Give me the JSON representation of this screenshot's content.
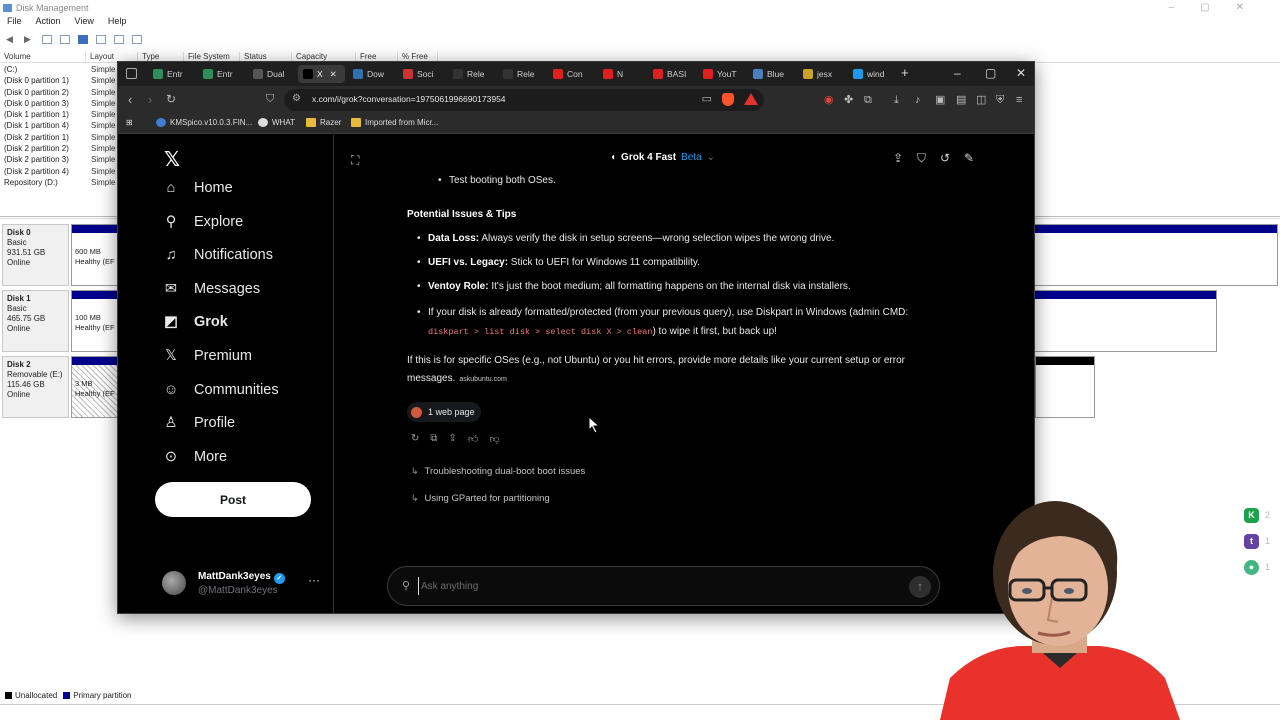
{
  "disk_management": {
    "title": "Disk Management",
    "menu": [
      "File",
      "Action",
      "View",
      "Help"
    ],
    "columns": [
      "Volume",
      "Layout",
      "Type",
      "File System",
      "Status",
      "Capacity",
      "Free Spa...",
      "% Free"
    ],
    "volumes": [
      {
        "name": "(C:)",
        "layout": "Simple"
      },
      {
        "name": "(Disk 0 partition 1)",
        "layout": "Simple"
      },
      {
        "name": "(Disk 0 partition 2)",
        "layout": "Simple"
      },
      {
        "name": "(Disk 0 partition 3)",
        "layout": "Simple"
      },
      {
        "name": "(Disk 1 partition 1)",
        "layout": "Simple"
      },
      {
        "name": "(Disk 1 partition 4)",
        "layout": "Simple"
      },
      {
        "name": "(Disk 2 partition 1)",
        "layout": "Simple"
      },
      {
        "name": "(Disk 2 partition 2)",
        "layout": "Simple"
      },
      {
        "name": "(Disk 2 partition 3)",
        "layout": "Simple"
      },
      {
        "name": "(Disk 2 partition 4)",
        "layout": "Simple"
      },
      {
        "name": "Repository (D:)",
        "layout": "Simple"
      }
    ],
    "disks": [
      {
        "name": "Disk 0",
        "type": "Basic",
        "size": "931.51 GB",
        "status": "Online",
        "part_size": "600 MB",
        "part_status": "Healthy (EF"
      },
      {
        "name": "Disk 1",
        "type": "Basic",
        "size": "465.75 GB",
        "status": "Online",
        "part_size": "100 MB",
        "part_status": "Healthy (EF"
      },
      {
        "name": "Disk 2",
        "type": "Removable (E:)",
        "size": "115.46 GB",
        "status": "Online",
        "part_size": "3 MB",
        "part_status": "Healthy (EF"
      }
    ],
    "legend": [
      "Unallocated",
      "Primary partition"
    ]
  },
  "browser": {
    "tabs": [
      {
        "label": "Entr",
        "color": "#2f8f5b"
      },
      {
        "label": "Entr",
        "color": "#2f8f5b"
      },
      {
        "label": "Dual",
        "color": "#555555"
      },
      {
        "label": "X",
        "color": "#000000"
      },
      {
        "label": "Dow",
        "color": "#2f6fb3"
      },
      {
        "label": "Soci",
        "color": "#cc3333"
      },
      {
        "label": "Rele",
        "color": "#333333"
      },
      {
        "label": "Rele",
        "color": "#333333"
      },
      {
        "label": "Con",
        "color": "#e02020"
      },
      {
        "label": "N",
        "color": "#e02020"
      },
      {
        "label": "BASI",
        "color": "#e02020"
      },
      {
        "label": "YouT",
        "color": "#e02020"
      },
      {
        "label": "Blue",
        "color": "#4a7fbf"
      },
      {
        "label": "jesx",
        "color": "#c9a227"
      },
      {
        "label": "wind",
        "color": "#1d9bf0"
      }
    ],
    "url": "x.com/i/grok?conversation=1975061996690173954",
    "bookmarks": [
      "KMSpico.v10.0.3.FIN...",
      "WHAT",
      "Razer",
      "Imported from Micr..."
    ]
  },
  "x": {
    "nav": [
      {
        "label": "Home",
        "icon": "home-icon",
        "glyph": "⌂"
      },
      {
        "label": "Explore",
        "icon": "search-icon",
        "glyph": "⚲"
      },
      {
        "label": "Notifications",
        "icon": "bell-icon",
        "glyph": "♫"
      },
      {
        "label": "Messages",
        "icon": "envelope-icon",
        "glyph": "✉"
      },
      {
        "label": "Grok",
        "icon": "grok-icon",
        "glyph": "◩"
      },
      {
        "label": "Premium",
        "icon": "x-premium-icon",
        "glyph": "𝕏"
      },
      {
        "label": "Communities",
        "icon": "people-icon",
        "glyph": "☺"
      },
      {
        "label": "Profile",
        "icon": "person-icon",
        "glyph": "♙"
      },
      {
        "label": "More",
        "icon": "more-circle-icon",
        "glyph": "⊙"
      }
    ],
    "post_label": "Post",
    "profile": {
      "name": "MattDank3eyes",
      "handle": "@MattDank3eyes"
    },
    "model": {
      "name": "Grok 4 Fast",
      "badge": "Beta"
    },
    "chat": {
      "bullet_top": "Test booting both OSes.",
      "section_title": "Potential Issues & Tips",
      "tips": [
        {
          "bold": "Data Loss:",
          "text": " Always verify the disk in setup screens—wrong selection wipes the wrong drive."
        },
        {
          "bold": "UEFI vs. Legacy:",
          "text": " Stick to UEFI for Windows 11 compatibility."
        },
        {
          "bold": "Ventoy Role:",
          "text": " It's just the boot medium; all formatting happens on the internal disk via installers."
        }
      ],
      "last_tip_pre": "If your disk is already formatted/protected (from your previous query), use Diskpart in Windows (admin CMD: ",
      "last_tip_code": "diskpart > list disk > select disk X > clean",
      "last_tip_post": ") to wipe it first, but back up!",
      "closing": "If this is for specific OSes (e.g., not Ubuntu) or you hit errors, provide more details like your current setup or error messages.",
      "citation": "askubuntu.com",
      "web_pages": "1 web page"
    },
    "suggestions": [
      "Troubleshooting dual-boot boot issues",
      "Using GParted for partitioning"
    ],
    "ask_placeholder": "Ask anything"
  },
  "side_icons": [
    {
      "letter": "K",
      "color": "#1ca34a",
      "count": "2"
    },
    {
      "letter": "t",
      "color": "#6441a5",
      "count": "1"
    },
    {
      "letter": "●",
      "color": "#43b581",
      "count": "1"
    }
  ]
}
